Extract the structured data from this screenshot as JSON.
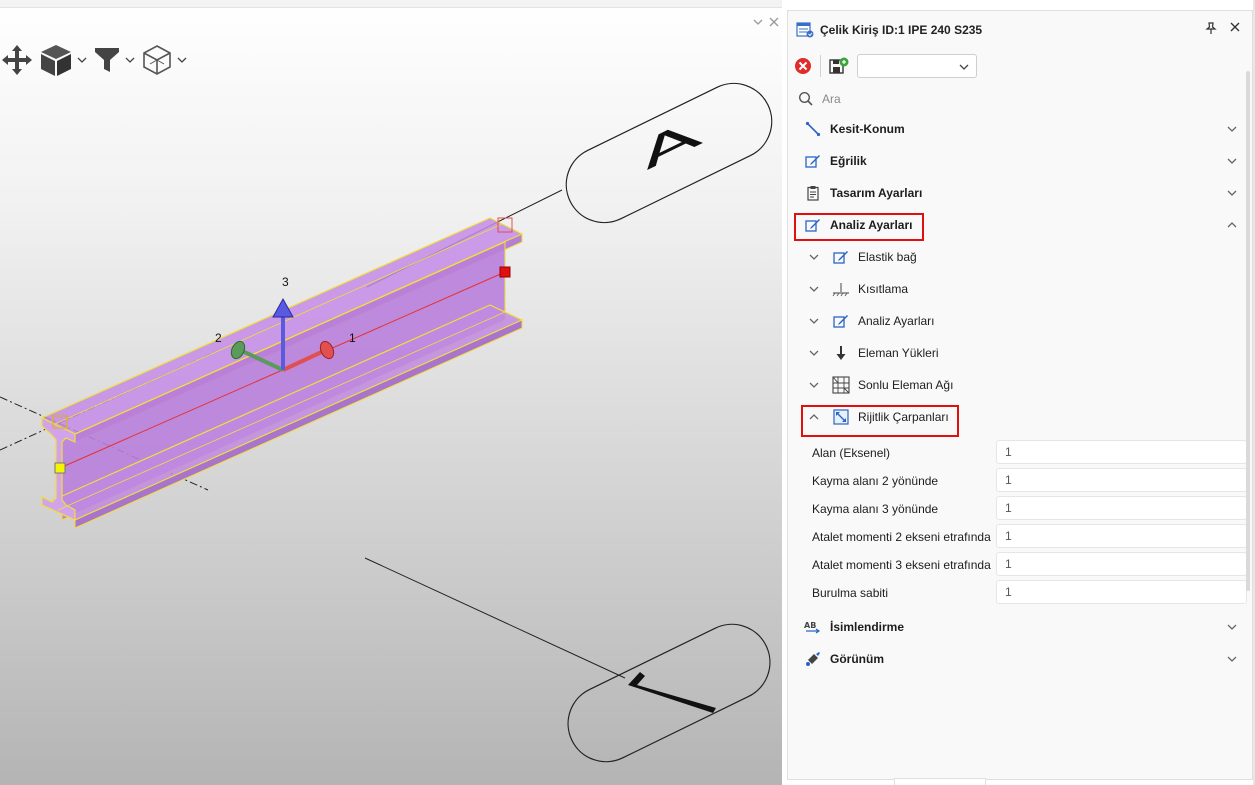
{
  "viewport": {
    "axis_labels": {
      "x": "1",
      "y": "2",
      "z": "3"
    },
    "grid_labels": {
      "a": "A",
      "b": "1"
    },
    "colors": {
      "beam_fill": "#c48be6",
      "beam_outline": "#f0de3a",
      "axis_1": "#e05050",
      "axis_2": "#5a9a5a",
      "axis_3": "#5a5ae0"
    },
    "toolbar": [
      {
        "name": "move-icon"
      },
      {
        "name": "cube-view-icon"
      },
      {
        "name": "filter-icon"
      },
      {
        "name": "box-select-icon"
      }
    ]
  },
  "panel": {
    "title": "Çelik Kiriş ID:1 IPE 240 S235",
    "toolbar": {
      "dropdown_value": ""
    },
    "search": {
      "placeholder": "Ara"
    },
    "sections": [
      {
        "label": "Kesit-Konum",
        "icon": "line-icon",
        "expanded": false
      },
      {
        "label": "Eğrilik",
        "icon": "edit-icon",
        "expanded": false
      },
      {
        "label": "Tasarım Ayarları",
        "icon": "clipboard-icon",
        "expanded": false
      },
      {
        "label": "Analiz Ayarları",
        "icon": "edit-icon",
        "expanded": true
      }
    ],
    "subsections": [
      {
        "label": "Elastik bağ",
        "icon": "edit-icon",
        "expanded": false
      },
      {
        "label": "Kısıtlama",
        "icon": "support-icon",
        "expanded": false
      },
      {
        "label": "Analiz Ayarları",
        "icon": "edit-icon",
        "expanded": false
      },
      {
        "label": "Eleman Yükleri",
        "icon": "arrow-down-icon",
        "expanded": false
      },
      {
        "label": "Sonlu Eleman Ağı",
        "icon": "mesh-icon",
        "expanded": false
      },
      {
        "label": "Rijitlik Çarpanları",
        "icon": "scale-icon",
        "expanded": true
      }
    ],
    "properties": [
      {
        "label": "Alan (Eksenel)",
        "value": "1"
      },
      {
        "label": "Kayma alanı 2 yönünde",
        "value": "1"
      },
      {
        "label": "Kayma alanı 3 yönünde",
        "value": "1"
      },
      {
        "label": "Atalet momenti 2 ekseni etrafında",
        "value": "1"
      },
      {
        "label": "Atalet momenti 3 ekseni etrafında",
        "value": "1"
      },
      {
        "label": "Burulma sabiti",
        "value": "1"
      }
    ],
    "bottom_sections": [
      {
        "label": "İsimlendirme",
        "icon": "ab-icon",
        "expanded": false
      },
      {
        "label": "Görünüm",
        "icon": "paint-icon",
        "expanded": false
      }
    ],
    "highlight_color": "#e01010"
  }
}
